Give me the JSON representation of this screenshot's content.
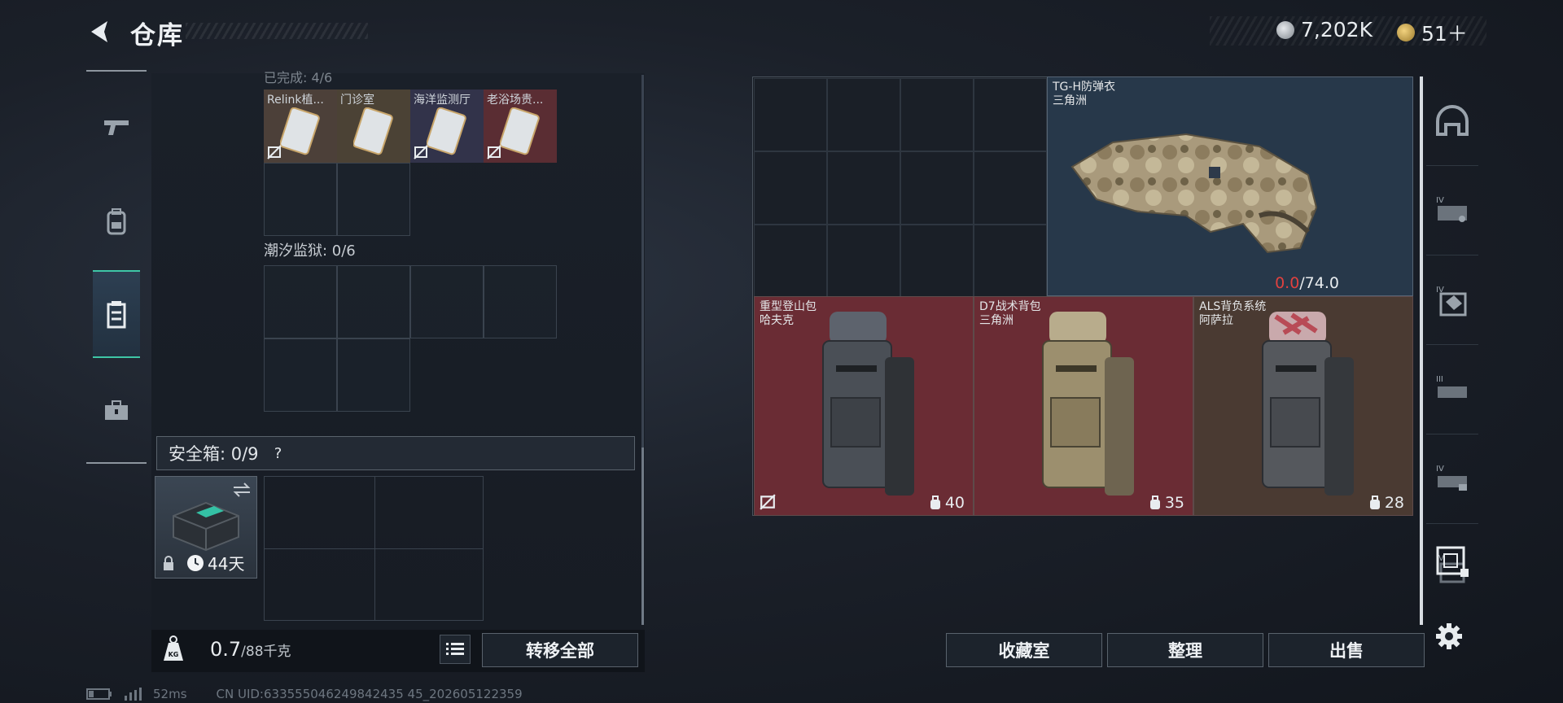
{
  "header": {
    "title": "仓库",
    "currency1_value": "7,202K",
    "currency2_value": "51＋"
  },
  "left_rail": {
    "items": [
      {
        "name": "firearms-tab"
      },
      {
        "name": "equipment-tab"
      },
      {
        "name": "storage-tab",
        "active": true
      },
      {
        "name": "toolbox-tab"
      }
    ]
  },
  "left_panel": {
    "top_section_label": "已完成: 4/6",
    "keys": [
      {
        "name": "Relink植...",
        "bg": "#4c4039"
      },
      {
        "name": "门诊室",
        "bg": "#4b4235"
      },
      {
        "name": "海洋监测厅",
        "bg": "#32334a"
      },
      {
        "name": "老浴场贵...",
        "bg": "#5a2d33"
      }
    ],
    "section2_label": "潮汐监狱: 0/6",
    "safe": {
      "label": "安全箱: 0/9",
      "help": "?",
      "item_days": "44天"
    },
    "weight": {
      "value": "0.7",
      "unit": "/88千克"
    },
    "transfer_all": "转移全部"
  },
  "right_panel": {
    "armor": {
      "name": "TG-H防弹衣",
      "maker": "三角洲",
      "durability_current": "0.0",
      "durability_max": "/74.0"
    },
    "bags": [
      {
        "name": "重型登山包",
        "maker": "哈夫克",
        "capacity": "40",
        "bg": "#6a2c34"
      },
      {
        "name": "D7战术背包",
        "maker": "三角洲",
        "capacity": "35",
        "bg": "#6a2c34"
      },
      {
        "name": "ALS背负系统",
        "maker": "阿萨拉",
        "capacity": "28",
        "bg": "#4a3a32"
      }
    ]
  },
  "bottom_buttons": {
    "collection": "收藏室",
    "sort": "整理",
    "sell": "出售"
  },
  "status": {
    "ping": "52ms",
    "uid": "CN UID:633555046249842435 45_202605122359"
  },
  "colors": {
    "accent": "#3ec6a6",
    "danger": "#e0413f"
  }
}
